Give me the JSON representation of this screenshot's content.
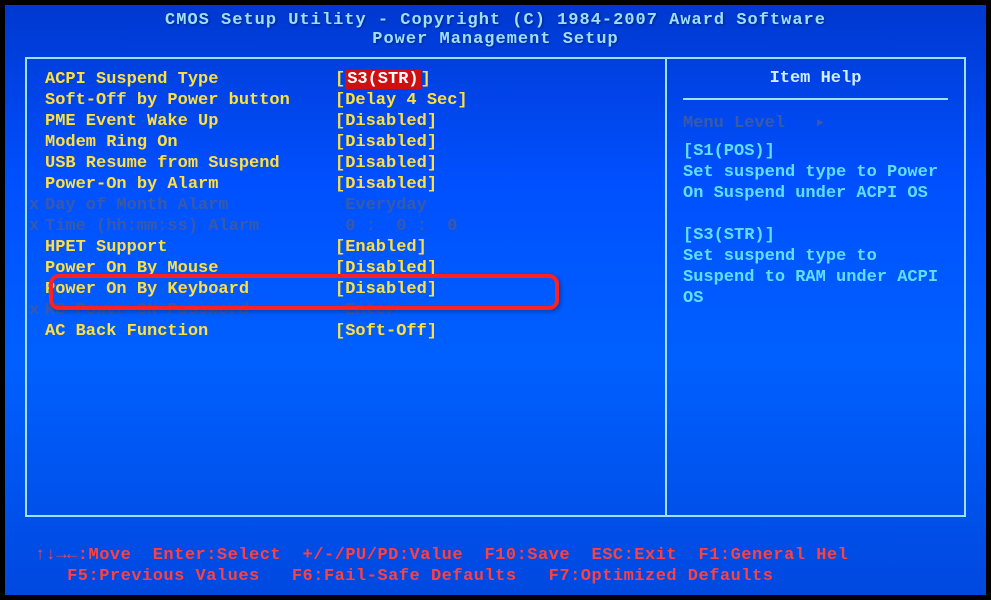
{
  "header": {
    "line1": "CMOS Setup Utility - Copyright (C) 1984-2007 Award Software",
    "line2": "Power Management Setup"
  },
  "settings": [
    {
      "label": "ACPI Suspend Type",
      "value": "S3(STR)",
      "selected": true,
      "kind": "yellow"
    },
    {
      "label": "Soft-Off by Power button",
      "value": "Delay 4 Sec",
      "selected": false,
      "kind": "yellow"
    },
    {
      "label": "PME Event Wake Up",
      "value": "Disabled",
      "selected": false,
      "kind": "yellow"
    },
    {
      "label": "Modem Ring On",
      "value": "Disabled",
      "selected": false,
      "kind": "yellow"
    },
    {
      "label": "USB Resume from Suspend",
      "value": "Disabled",
      "selected": false,
      "kind": "yellow"
    },
    {
      "label": "Power-On by Alarm",
      "value": "Disabled",
      "selected": false,
      "kind": "yellow"
    },
    {
      "label": "Day of Month Alarm",
      "value": "Everyday",
      "selected": false,
      "kind": "disabled",
      "x": true
    },
    {
      "label": "Time (hh:mm:ss) Alarm",
      "value": "0 :  0 :  0",
      "selected": false,
      "kind": "disabled",
      "x": true
    },
    {
      "label": "HPET Support",
      "value": "Enabled",
      "selected": false,
      "kind": "yellow"
    },
    {
      "label": "Power On By Mouse",
      "value": "Disabled",
      "selected": false,
      "kind": "yellow"
    },
    {
      "label": "Power On By Keyboard",
      "value": "Disabled",
      "selected": false,
      "kind": "yellow",
      "highlight": true
    },
    {
      "label": "KB Power ON Password",
      "value": "Enter",
      "selected": false,
      "kind": "disabled",
      "x": true
    },
    {
      "label": "AC Back Function",
      "value": "Soft-Off",
      "selected": false,
      "kind": "yellow"
    }
  ],
  "help": {
    "title": "Item Help",
    "menu_level": "Menu Level",
    "body_s1_title": "[S1(POS)]",
    "body_s1_text": "Set suspend type to Power On Suspend under ACPI OS",
    "body_s3_title": "[S3(STR)]",
    "body_s3_text": "Set suspend type to Suspend to RAM under ACPI OS"
  },
  "footer": {
    "line1": "↑↓→←:Move  Enter:Select  +/-/PU/PD:Value  F10:Save  ESC:Exit  F1:General Hel",
    "line2": "   F5:Previous Values   F6:Fail-Safe Defaults   F7:Optimized Defaults"
  }
}
